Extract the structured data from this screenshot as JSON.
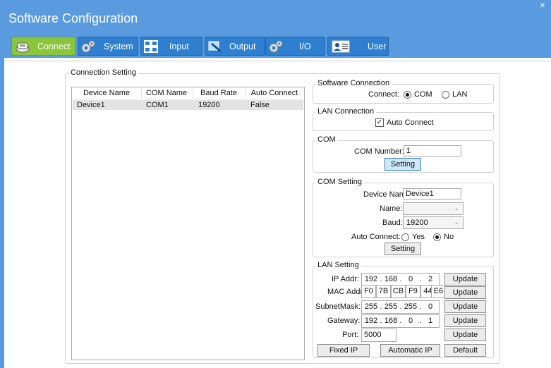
{
  "window": {
    "title": "Software Configuration"
  },
  "tabs": [
    {
      "label": "Connect",
      "icon": "connect-icon",
      "active": true
    },
    {
      "label": "System",
      "icon": "gears-icon"
    },
    {
      "label": "Input",
      "icon": "grid-icon"
    },
    {
      "label": "Output",
      "icon": "output-icon"
    },
    {
      "label": "I/O",
      "icon": "gears-icon"
    },
    {
      "label": "User",
      "icon": "user-card-icon"
    }
  ],
  "connection_setting": {
    "title": "Connection Setting",
    "columns": [
      "Device Name",
      "COM Name",
      "Baud Rate",
      "Auto Connect"
    ],
    "rows": [
      [
        "Device1",
        "COM1",
        "19200",
        "False"
      ]
    ]
  },
  "software_connection": {
    "title": "Software Connection",
    "connect_label": "Connect:",
    "options": [
      "COM",
      "LAN"
    ],
    "selected": "COM"
  },
  "lan_connection": {
    "title": "LAN Connection",
    "auto_connect_label": "Auto Connect",
    "auto_connect_checked": true
  },
  "com": {
    "title": "COM",
    "com_number_label": "COM Number:",
    "com_number_value": "1",
    "setting_button": "Setting"
  },
  "com_setting": {
    "title": "COM Setting",
    "device_name_label": "Device Name:",
    "device_name_value": "Device1",
    "name_label": "Name:",
    "name_value": "",
    "baud_label": "Baud:",
    "baud_value": "19200",
    "auto_connect_label": "Auto Connect:",
    "yes_label": "Yes",
    "no_label": "No",
    "auto_connect_selected": "No",
    "setting_button": "Setting"
  },
  "lan_setting": {
    "title": "LAN Setting",
    "ip_label": "IP Addr:",
    "ip": [
      "192",
      "168",
      "0",
      "2"
    ],
    "mac_label": "MAC Addr:",
    "mac": [
      "F0",
      "7B",
      "CB",
      "F9",
      "44",
      "E6"
    ],
    "subnet_label": "SubnetMask:",
    "subnet": [
      "255",
      "255",
      "255",
      "0"
    ],
    "gateway_label": "Gateway:",
    "gateway": [
      "192",
      "168",
      "0",
      "1"
    ],
    "port_label": "Port:",
    "port_value": "5000",
    "update_button": "Update",
    "fixed_ip_button": "Fixed IP",
    "automatic_ip_button": "Automatic IP",
    "default_button": "Default"
  },
  "colors": {
    "title_bar": "#5a9be0",
    "tab_blue": "#2e7fd0",
    "tab_active_green": "#8ac63a",
    "highlight_button": "#cde7fb",
    "selected_row": "#e3e3e3"
  }
}
